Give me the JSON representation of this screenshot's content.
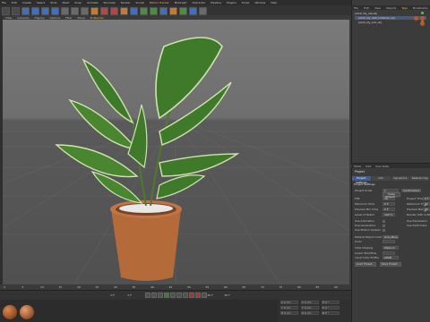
{
  "menubar": {
    "items": [
      "File",
      "Edit",
      "Create",
      "Select",
      "Tools",
      "Mesh",
      "Snap",
      "Animate",
      "Simulate",
      "Render",
      "Sculpt",
      "Motion Tracker",
      "MoGraph",
      "Character",
      "Pipeline",
      "Plugins",
      "Script",
      "Window",
      "Help"
    ],
    "highlighted": "Motion Tracker"
  },
  "viewport_menu": {
    "items": [
      "View",
      "Cameras",
      "Display",
      "Options",
      "Filter",
      "Panel",
      "ProRender"
    ],
    "highlighted": "ProRender"
  },
  "object_manager": {
    "tabs": [
      "File",
      "Edit",
      "View",
      "Objects",
      "Tags",
      "Bookmarks"
    ],
    "highlighted_tab": "Tags",
    "objects": [
      {
        "name": "plant_lily_obj.obj"
      },
      {
        "name": "plant_lily_leaf_material_obj"
      },
      {
        "name": "plant_lily_pot_obj"
      }
    ]
  },
  "attribute_manager": {
    "header_tabs": [
      "Mode",
      "Edit",
      "User Data"
    ],
    "title": "Project",
    "tabs": [
      "Project Settings",
      "Info",
      "Dynamics",
      "Referencing"
    ],
    "active_tab": "Project Settings",
    "section": "Project Settings",
    "fields": [
      {
        "label": "Project Scale",
        "value": "1",
        "unit": "Centimeters"
      },
      {
        "label": "FPS",
        "value": "30",
        "right_label": "Project Time",
        "right_value": "0 F"
      },
      {
        "label": "Minimum Time",
        "value": "0 F",
        "right_label": "Maximum Time",
        "right_value": "90 F"
      },
      {
        "label": "Preview Min Time",
        "value": "0 F",
        "right_label": "Preview Max Time",
        "right_value": "90 F"
      },
      {
        "label": "Level of Detail",
        "value": "100 %",
        "right_label": "Render LOD in Editor",
        "right_value": ""
      },
      {
        "label": "Use Animation",
        "value": "",
        "right_label": "Use Expression",
        "right_value": ""
      },
      {
        "label": "Use Generators",
        "value": "",
        "right_label": "Use Deformers",
        "right_value": ""
      },
      {
        "label": "Use Motion System",
        "value": "",
        "right_label": "",
        "right_value": ""
      },
      {
        "label": "Default Object Color",
        "value": "Gray-Blue"
      },
      {
        "label": "Color",
        "value": ""
      },
      {
        "label": "View Clipping",
        "value": "Medium"
      },
      {
        "label": "Linear Workflow",
        "value": ""
      },
      {
        "label": "Input Color Profile",
        "value": "sRGB"
      }
    ],
    "buttons": [
      "Load Preset...",
      "Save Preset..."
    ],
    "scale_button": "Scale Project..."
  },
  "timeline": {
    "ticks": [
      "0",
      "5",
      "10",
      "15",
      "20",
      "25",
      "30",
      "35",
      "40",
      "45",
      "50",
      "55",
      "60",
      "65",
      "70",
      "75",
      "80",
      "85",
      "90"
    ],
    "start": "0 F",
    "current": "0 F",
    "end": "90 F",
    "end2": "90 F"
  },
  "coordinates": {
    "rows": [
      [
        "X",
        "0 cm",
        "X",
        "0 cm",
        "H",
        "0 °"
      ],
      [
        "Y",
        "0 cm",
        "Y",
        "0 cm",
        "P",
        "0 °"
      ],
      [
        "Z",
        "0 cm",
        "Z",
        "0 cm",
        "B",
        "0 °"
      ]
    ]
  },
  "colors": {
    "accent": "#ffb347",
    "selection": "#3d5d9c",
    "leaf_dark": "#3f7a2a",
    "leaf_light": "#cfe3b0",
    "pot": "#b56a3a"
  }
}
